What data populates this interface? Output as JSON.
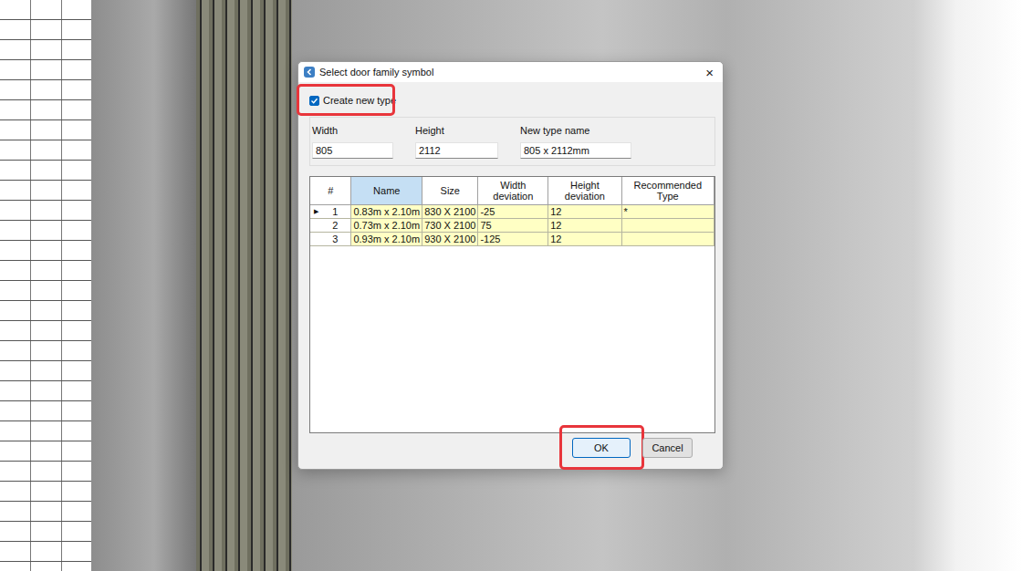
{
  "window": {
    "title": "Select door family symbol",
    "close": "×"
  },
  "create_new_type": {
    "label": "Create new type",
    "checked": true,
    "highlighted": true
  },
  "fields": [
    {
      "label": "Width",
      "value": "805"
    },
    {
      "label": "Height",
      "value": "2112"
    },
    {
      "label": "New type name",
      "value": "805 x 2112mm"
    }
  ],
  "table": {
    "columns": [
      {
        "label": "#",
        "highlighted": false
      },
      {
        "label": "Name",
        "highlighted": true
      },
      {
        "label": "Size",
        "highlighted": false
      },
      {
        "label": "Width deviation",
        "highlighted": false
      },
      {
        "label": "Height deviation",
        "highlighted": false
      },
      {
        "label": "Recommended Type",
        "highlighted": false
      }
    ],
    "current_marker": "▶",
    "rows": [
      {
        "cells": [
          "1",
          "0.83m x 2.10m",
          "830 X 2100",
          "-25",
          "12",
          "*"
        ],
        "selected": true
      },
      {
        "cells": [
          "2",
          "0.73m x 2.10m",
          "730 X 2100",
          "75",
          "12",
          ""
        ],
        "selected": false
      },
      {
        "cells": [
          "3",
          "0.93m x 2.10m",
          "930 X 2100",
          "-125",
          "12",
          ""
        ],
        "selected": false
      }
    ]
  },
  "buttons": [
    {
      "label": "OK",
      "default": true,
      "highlighted": true
    },
    {
      "label": "Cancel",
      "default": false,
      "highlighted": false
    }
  ]
}
